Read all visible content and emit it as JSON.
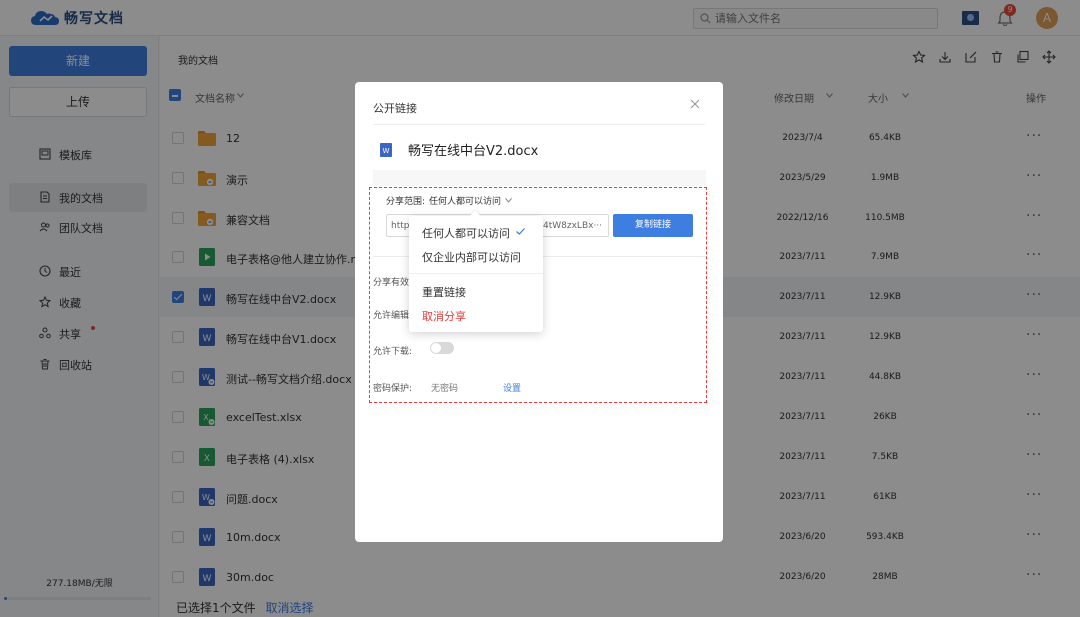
{
  "app": {
    "name": "畅写文档"
  },
  "search": {
    "placeholder": "请输入文件名"
  },
  "notifications": {
    "count": "9"
  },
  "user": {
    "avatar_letter": "A"
  },
  "sidebar": {
    "new_label": "新建",
    "upload_label": "上传",
    "items": [
      {
        "label": "模板库",
        "icon": "template-icon"
      },
      {
        "label": "我的文档",
        "icon": "document-icon"
      },
      {
        "label": "团队文档",
        "icon": "team-icon"
      },
      {
        "label": "最近",
        "icon": "clock-icon"
      },
      {
        "label": "收藏",
        "icon": "star-icon"
      },
      {
        "label": "共享",
        "icon": "share-icon"
      },
      {
        "label": "回收站",
        "icon": "trash-icon"
      }
    ],
    "storage_text": "277.18MB/无限"
  },
  "main": {
    "breadcrumb": "我的文档",
    "columns": {
      "name": "文档名称",
      "modified": "修改日期",
      "size": "大小",
      "actions": "操作"
    },
    "files": [
      {
        "name": "12",
        "type": "folder",
        "date": "2023/7/4",
        "size": "65.4KB"
      },
      {
        "name": "演示",
        "type": "shared-folder",
        "date": "2023/5/29",
        "size": "1.9MB"
      },
      {
        "name": "兼容文档",
        "type": "shared-folder",
        "date": "2022/12/16",
        "size": "110.5MB"
      },
      {
        "name": "电子表格@他人建立协作.m",
        "type": "slides",
        "date": "2023/7/11",
        "size": "7.9MB"
      },
      {
        "name": "畅写在线中台V2.docx",
        "type": "word",
        "date": "2023/7/11",
        "size": "12.9KB"
      },
      {
        "name": "畅写在线中台V1.docx",
        "type": "word",
        "date": "2023/7/11",
        "size": "12.9KB"
      },
      {
        "name": "测试--畅写文档介绍.docx",
        "type": "word-shared",
        "date": "2023/7/11",
        "size": "44.8KB"
      },
      {
        "name": "excelTest.xlsx",
        "type": "excel-shared",
        "date": "2023/7/11",
        "size": "26KB"
      },
      {
        "name": "电子表格 (4).xlsx",
        "type": "excel",
        "date": "2023/7/11",
        "size": "7.5KB"
      },
      {
        "name": "问题.docx",
        "type": "word-shared",
        "date": "2023/7/11",
        "size": "61KB"
      },
      {
        "name": "10m.docx",
        "type": "word",
        "date": "2023/6/20",
        "size": "593.4KB"
      },
      {
        "name": "30m.doc",
        "type": "word",
        "date": "2023/6/20",
        "size": "28MB"
      }
    ],
    "footer": {
      "selected_text": "已选择1个文件",
      "cancel_label": "取消选择"
    }
  },
  "modal": {
    "title": "公开链接",
    "doc_name": "畅写在线中台V2.docx",
    "scope_label": "分享范围:",
    "scope_value": "任何人都可以访问",
    "link_prefix": "http",
    "link_tail": "4tW8zxLBx···",
    "copy_label": "复制链接",
    "option_expiry": "分享有效",
    "option_edit": "允许编辑",
    "option_download": "允许下载:",
    "option_password": "密码保护:",
    "password_value": "无密码",
    "password_set": "设置"
  },
  "dropdown": {
    "items": [
      "任何人都可以访问",
      "仅企业内部可以访问",
      "重置链接",
      "取消分享"
    ]
  },
  "colors": {
    "accent": "#3e7ee0",
    "danger": "#e23c3c"
  }
}
